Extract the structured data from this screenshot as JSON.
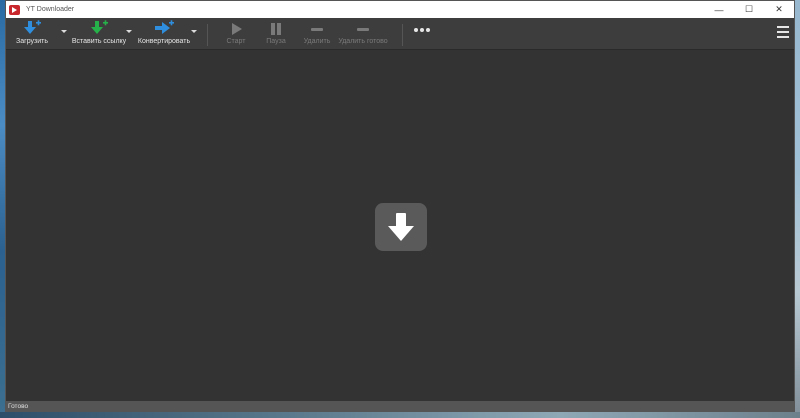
{
  "window": {
    "title": "YT Downloader",
    "controls": {
      "minimize": "—",
      "maximize": "☐",
      "close": "✕"
    }
  },
  "toolbar": {
    "download_label": "Загрузить",
    "paste_link_label": "Вставить ссылку",
    "convert_label": "Конвертировать",
    "start_label": "Старт",
    "pause_label": "Пауза",
    "delete_label": "Удалить",
    "delete_done_label": "Удалить готово"
  },
  "status": {
    "text": "Готово"
  },
  "colors": {
    "download_icon": "#2f8fde",
    "paste_icon": "#27b14a",
    "convert_icon": "#2f8fde",
    "disabled_icon": "#7a7a7a",
    "background": "#333333"
  },
  "icons": {
    "download": "download-arrow-icon",
    "paste": "paste-link-icon",
    "convert": "convert-icon",
    "start": "play-icon",
    "pause": "pause-icon",
    "delete": "minus-icon",
    "delete_done": "minus-icon",
    "more": "more-dots-icon",
    "menu": "hamburger-menu-icon",
    "drop": "drop-download-icon"
  }
}
